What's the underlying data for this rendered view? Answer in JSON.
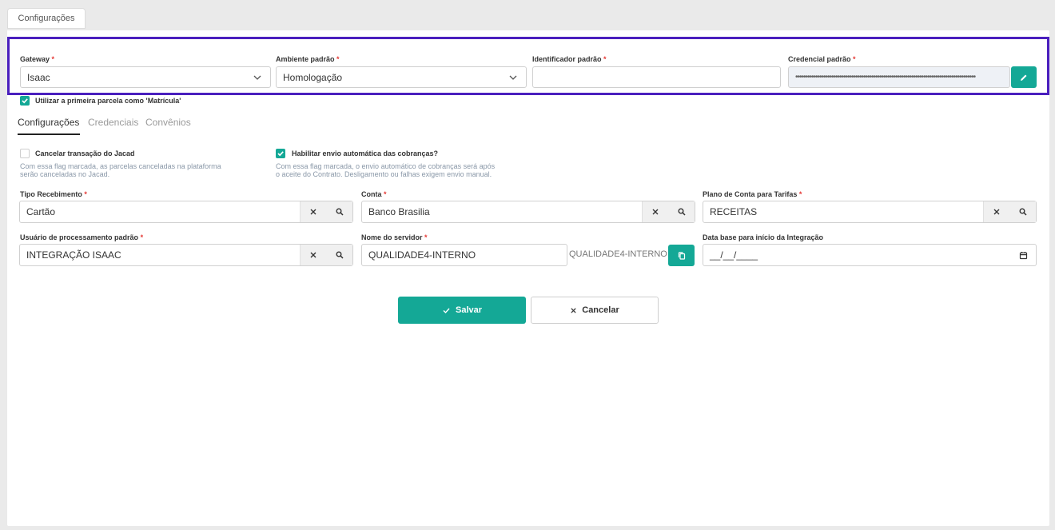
{
  "top_tab": "Configurações",
  "gateway": {
    "gateway_label": "Gateway",
    "gateway_value": "Isaac",
    "ambiente_label": "Ambiente padrão",
    "ambiente_value": "Homologação",
    "identificador_label": "Identificador padrão",
    "identificador_value": "",
    "credencial_label": "Credencial padrão",
    "credencial_value": "••••••••••••••••••••••••••••••••••••••••••••••••••••••••••••••••••••••••••••••••••••••••••"
  },
  "matricula": {
    "label": "Utilizar a primeira parcela como 'Matrícula'",
    "checked": true
  },
  "tabs": [
    {
      "label": "Configurações",
      "active": true
    },
    {
      "label": "Credenciais",
      "active": false
    },
    {
      "label": "Convênios",
      "active": false
    }
  ],
  "options": {
    "cancelar": {
      "label": "Cancelar transação do Jacad",
      "checked": false,
      "help1": "Com essa flag marcada, as parcelas canceladas na plataforma",
      "help2": "serão canceladas no Jacad."
    },
    "habilitar": {
      "label": "Habilitar envio automática das cobranças?",
      "checked": true,
      "help1": "Com essa flag marcada, o envio automático de cobranças será após",
      "help2": "o aceite do Contrato. Desligamento ou falhas exigem envio manual."
    }
  },
  "fields": {
    "tipo_label": "Tipo Recebimento",
    "tipo_value": "Cartão",
    "conta_label": "Conta",
    "conta_value": "Banco Brasilia",
    "plano_label": "Plano de Conta para Tarifas",
    "plano_value": "RECEITAS",
    "usuario_label": "Usuário de processamento padrão",
    "usuario_value": "INTEGRAÇÃO ISAAC",
    "servidor_label": "Nome do servidor",
    "servidor_value": "QUALIDADE4-INTERNO",
    "servidor_text": "QUALIDADE4-INTERNO",
    "data_label": "Data base para início da Integração",
    "data_value": "__/__/____"
  },
  "actions": {
    "save": "Salvar",
    "cancel": "Cancelar"
  },
  "colors": {
    "accent": "#14a896",
    "highlight_border": "#4a1fbe",
    "required": "#e53935"
  }
}
